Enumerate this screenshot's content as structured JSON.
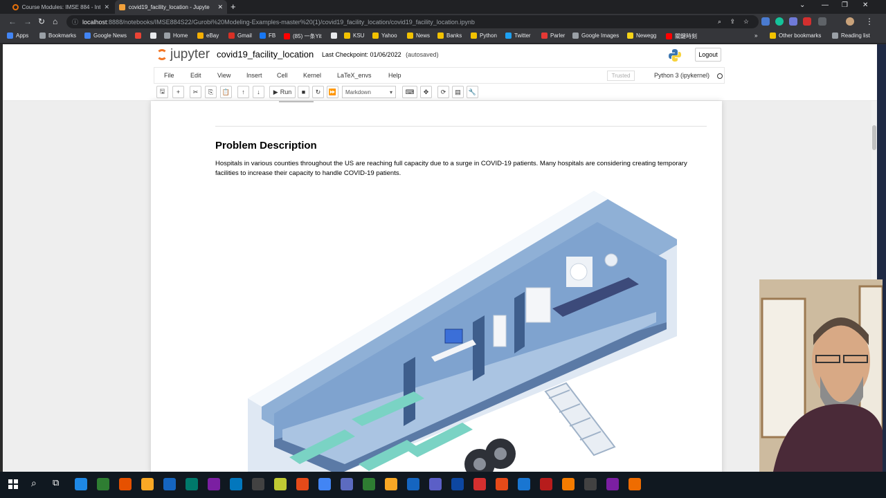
{
  "browser": {
    "tabs": [
      {
        "label": "Course Modules: IMSE 884 - Inte",
        "active": false
      },
      {
        "label": "covid19_facility_location - Jupyte",
        "active": true
      }
    ],
    "url_host": "localhost",
    "url_rest": ":8888/notebooks/IMSE884S22/Gurobi%20Modeling-Examples-master%20(1)/covid19_facility_location/covid19_facility_location.ipynb",
    "bookmarks": [
      {
        "label": "Apps",
        "color": "#4285f4"
      },
      {
        "label": "Bookmarks",
        "color": "#9aa0a6"
      },
      {
        "label": "Google News",
        "color": "#4285f4"
      },
      {
        "label": "",
        "color": "#ea4335"
      },
      {
        "label": "",
        "color": "#e8eaed"
      },
      {
        "label": "Home",
        "color": "#9aa0a6"
      },
      {
        "label": "eBay",
        "color": "#f5af02"
      },
      {
        "label": "Gmail",
        "color": "#d93025"
      },
      {
        "label": "FB",
        "color": "#1877f2"
      },
      {
        "label": "(85) 一条Yit",
        "color": "#ff0000"
      },
      {
        "label": "",
        "color": "#e8eaed"
      },
      {
        "label": "KSU",
        "color": "#f2c200"
      },
      {
        "label": "Yahoo",
        "color": "#f2c200"
      },
      {
        "label": "News",
        "color": "#f2c200"
      },
      {
        "label": "Banks",
        "color": "#f2c200"
      },
      {
        "label": "Python",
        "color": "#f2c200"
      },
      {
        "label": "Twitter",
        "color": "#1da1f2"
      },
      {
        "label": "Parler",
        "color": "#e53935"
      },
      {
        "label": "Google Images",
        "color": "#9aa0a6"
      },
      {
        "label": "Newegg",
        "color": "#f7d417"
      },
      {
        "label": "關鍵時刻",
        "color": "#ff0000"
      }
    ],
    "other_bookmarks": "Other bookmarks",
    "reading_list": "Reading list",
    "more_chevron": "»"
  },
  "jupyter": {
    "logo_text": "jupyter",
    "notebook_title": "covid19_facility_location",
    "checkpoint": "Last Checkpoint: 01/06/2022",
    "autosaved": "(autosaved)",
    "logout": "Logout",
    "menu": [
      "File",
      "Edit",
      "View",
      "Insert",
      "Cell",
      "Kernel",
      "LaTeX_envs",
      "Help"
    ],
    "trusted": "Trusted",
    "kernel": "Python 3 (ipykernel)",
    "toolbar_run": "Run",
    "cell_type": "Markdown"
  },
  "cell": {
    "heading": "Problem Description",
    "paragraph": "Hospitals in various counties throughout the US are reaching full capacity due to a surge in COVID-19 patients. Many hospitals are considering creating temporary facilities to increase their capacity to handle COVID-19 patients."
  },
  "colors": {
    "jupyter_orange": "#f37726",
    "tab_bg": "#202124",
    "chrome_bg": "#35363a",
    "taskbar_bg": "#101820"
  }
}
